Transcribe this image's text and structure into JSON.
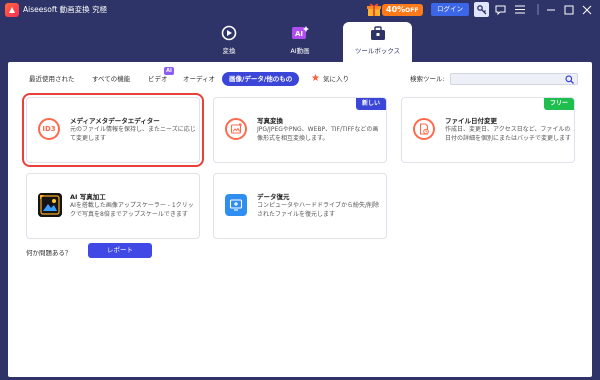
{
  "app": {
    "title": "Aiseesoft 動画変換 究極"
  },
  "promo": {
    "percent": "40%",
    "suffix": "OFF"
  },
  "toolbar": {
    "login_label": "ログイン"
  },
  "main_tabs": [
    {
      "label": "変換"
    },
    {
      "label": "AI動画"
    },
    {
      "label": "ツールボックス"
    }
  ],
  "categories": {
    "recent": "最近使用された",
    "all": "すべての機能",
    "video": "ビデオ",
    "audio": "オーディオ",
    "image": "画像/データ/他のもの",
    "favorites": "気に入り",
    "ai_badge": "AI"
  },
  "search": {
    "label": "検索ツール:",
    "value": ""
  },
  "cards": [
    {
      "title": "メディアメタデータエディター",
      "desc": "元のファイル情報を保持し、またニーズに応じて変更します",
      "icon": "id3-icon",
      "icon_text": "ID3"
    },
    {
      "title": "写真変換",
      "desc": "JPG/JPEGやPNG、WEBP、TIF/TIFFなどの画像形式を相互変換します。",
      "badge": "新しい",
      "icon": "photo-convert-icon"
    },
    {
      "title": "ファイル日付変更",
      "desc": "作成日、変更日、アクセス日など、ファイルの日付の詳細を個別にまたはバッチで変更します",
      "badge": "フリー",
      "icon": "file-date-icon"
    },
    {
      "title": "AI 写真加工",
      "desc": "AIを搭載した画像アップスケーラー - 1クリックで写真を8倍までアップスケールできます",
      "icon": "ai-photo-icon"
    },
    {
      "title": "データ復元",
      "desc": "コンピュータやハードドライブから紛失/削除されたファイルを復元します",
      "icon": "data-recovery-icon"
    }
  ],
  "footer": {
    "question": "何か問題ある？",
    "report_label": "レポート"
  },
  "colors": {
    "header_bg": "#2e3467",
    "accent": "#3b46d8",
    "promo": "#ff7a1a",
    "new_badge": "#3b46d8",
    "free_badge": "#1fbf4f",
    "icon_orange": "#ff6a4d",
    "selection": "#e8403a"
  }
}
